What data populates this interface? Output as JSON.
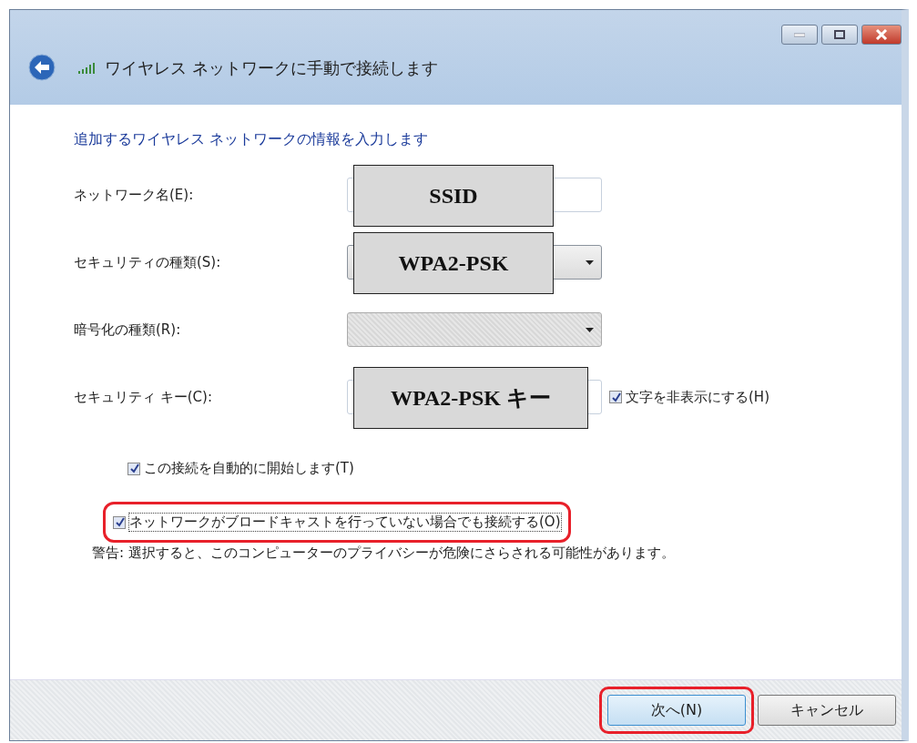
{
  "window": {
    "title": "ワイヤレス ネットワークに手動で接続します"
  },
  "heading": "追加するワイヤレス ネットワークの情報を入力します",
  "fields": [
    {
      "kind": "text",
      "label": "ネットワーク名(E):",
      "overlay": "SSID"
    },
    {
      "kind": "dropdown",
      "label": "セキュリティの種類(S):",
      "overlay": "WPA2-PSK",
      "disabled": false
    },
    {
      "kind": "dropdown",
      "label": "暗号化の種類(R):",
      "disabled": true
    },
    {
      "kind": "text",
      "label": "セキュリティ キー(C):",
      "overlay": "WPA2-PSK キー",
      "option": {
        "label": "文字を非表示にする(H)",
        "checked": true
      }
    }
  ],
  "options": [
    {
      "label": "この接続を自動的に開始します(T)",
      "checked": true,
      "highlighted": false
    },
    {
      "label": "ネットワークがブロードキャストを行っていない場合でも接続する(O)",
      "checked": true,
      "highlighted": true
    }
  ],
  "warning": "警告: 選択すると、このコンピューターのプライバシーが危険にさらされる可能性があります。",
  "buttons": [
    {
      "label": "次へ(N)",
      "highlighted": true
    },
    {
      "label": "キャンセル",
      "highlighted": false
    }
  ]
}
